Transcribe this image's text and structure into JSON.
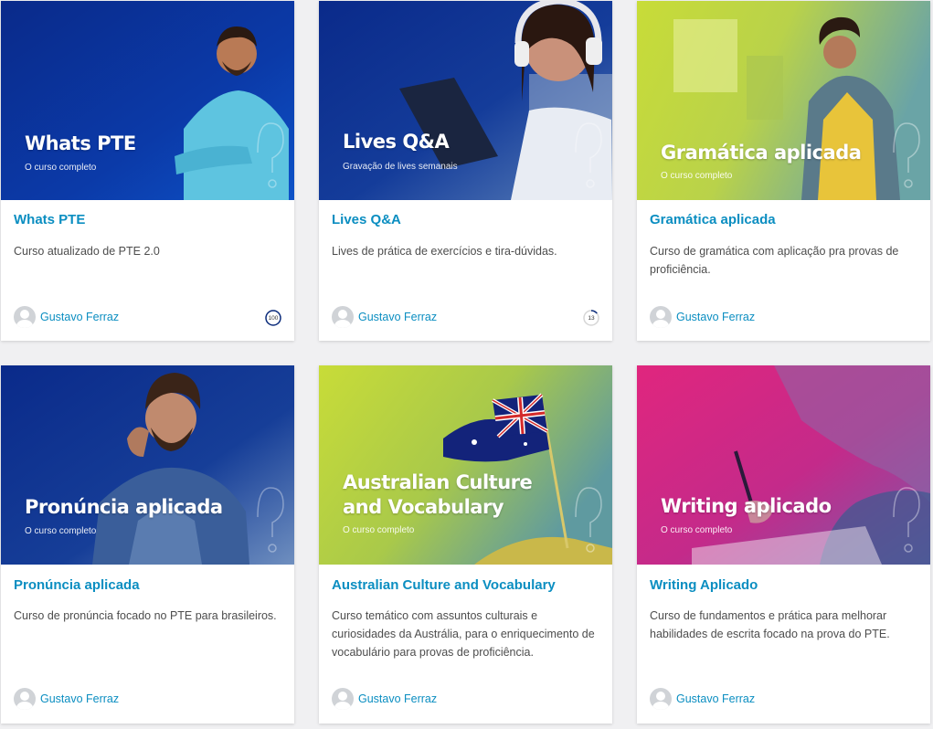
{
  "colors": {
    "title": "#0b8ec1",
    "author": "#0b8ec1",
    "desc": "#4d4d4d",
    "progress_complete": "#0a2a7a",
    "progress_partial": "#0a2a7a"
  },
  "courses": [
    {
      "thumb_title": "Whats PTE",
      "thumb_subtitle": "O curso completo",
      "title": "Whats PTE",
      "description": "Curso atualizado de PTE 2.0",
      "author": "Gustavo Ferraz",
      "progress": 100,
      "progress_label": "100"
    },
    {
      "thumb_title": "Lives Q&A",
      "thumb_subtitle": "Gravação de lives semanais",
      "title": "Lives Q&A",
      "description": "Lives de prática de exercícios e tira-dúvidas.",
      "author": "Gustavo Ferraz",
      "progress": 13,
      "progress_label": "13"
    },
    {
      "thumb_title": "Gramática aplicada",
      "thumb_subtitle": "O curso completo",
      "title": "Gramática aplicada",
      "description": "Curso de gramática com aplicação pra provas de proficiência.",
      "author": "Gustavo Ferraz"
    },
    {
      "thumb_title": "Pronúncia aplicada",
      "thumb_subtitle": "O curso completo",
      "title": "Pronúncia aplicada",
      "description": "Curso de pronúncia focado no PTE para brasileiros.",
      "author": "Gustavo Ferraz"
    },
    {
      "thumb_title_line1": "Australian Culture",
      "thumb_title_line2": "and Vocabulary",
      "thumb_subtitle": "O curso completo",
      "title": "Australian Culture and Vocabulary",
      "description": "Curso temático com assuntos culturais e curiosidades da Austrália, para o enriquecimento de vocabulário para provas de proficiência.",
      "author": "Gustavo Ferraz"
    },
    {
      "thumb_title": "Writing aplicado",
      "thumb_subtitle": "O curso completo",
      "title": "Writing Aplicado",
      "description": "Curso de fundamentos e prática para melhorar habilidades de escrita focado na prova do PTE.",
      "author": "Gustavo Ferraz"
    }
  ]
}
